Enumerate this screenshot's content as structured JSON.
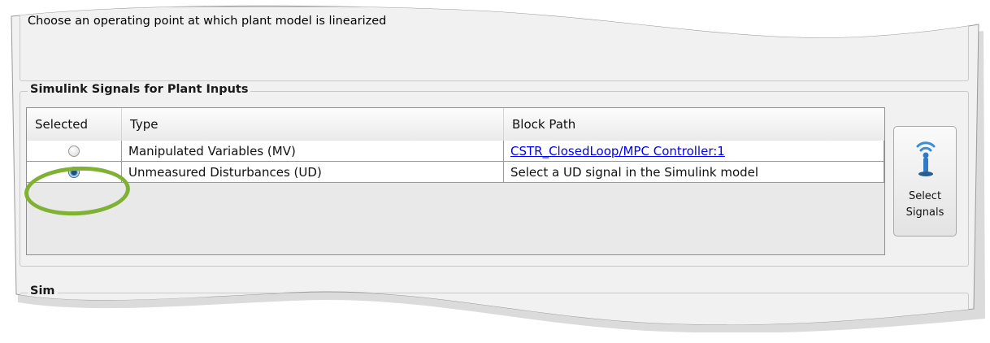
{
  "operating_point": {
    "description": "Choose an operating point at which plant model is linearized"
  },
  "plant_inputs": {
    "group_title": "Simulink Signals for Plant Inputs",
    "columns": [
      "Selected",
      "Type",
      "Block Path"
    ],
    "rows": [
      {
        "selected": false,
        "type": "Manipulated Variables (MV)",
        "block_path": "CSTR_ClosedLoop/MPC Controller:1",
        "block_path_is_link": true
      },
      {
        "selected": true,
        "type": "Unmeasured Disturbances (UD)",
        "block_path": "Select a UD signal in the Simulink model",
        "block_path_is_link": false
      }
    ],
    "select_button": {
      "label_line1": "Select",
      "label_line2": "Signals",
      "icon": "signal-probe-icon"
    }
  },
  "next_section": {
    "title": "Sim"
  },
  "colors": {
    "highlight_ring": "#7fb133",
    "link": "#0000ee",
    "panel_background": "#f1f1f1"
  }
}
